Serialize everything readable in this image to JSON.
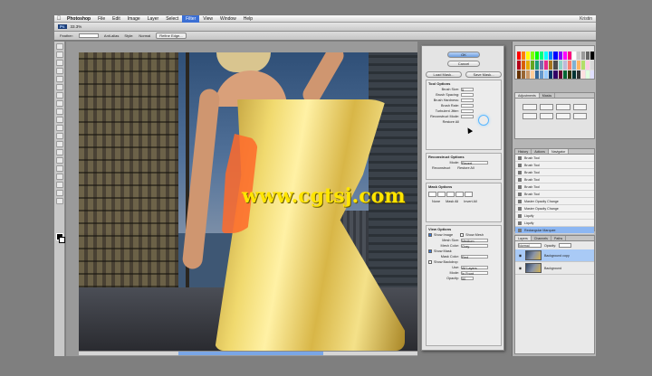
{
  "menubar": {
    "app": "Photoshop",
    "items": [
      "File",
      "Edit",
      "Image",
      "Layer",
      "Select",
      "Filter",
      "View",
      "Window",
      "Help"
    ],
    "active": "Filter",
    "right": "Kristin"
  },
  "appbar": {
    "ps": "Ps",
    "zoom": "33.3%",
    "right": ""
  },
  "optbar": {
    "label1": "Feather:",
    "label2": "Anti-alias",
    "label3": "Style:",
    "style_value": "Normal",
    "refine": "Refine Edge..."
  },
  "watermark": "www.cgtsj.com",
  "dialog": {
    "ok": "OK",
    "cancel": "Cancel",
    "load": "Load Mask...",
    "save": "Save Mask...",
    "tool_options": {
      "title": "Tool Options",
      "brush_size": "Brush Size:",
      "brush_size_value": "5",
      "rows": [
        {
          "label": "Brush Spacing:",
          "value": ""
        },
        {
          "label": "Brush Hardness:",
          "value": ""
        },
        {
          "label": "Brush Rate:",
          "value": ""
        },
        {
          "label": "Turbulent Jitter:",
          "value": ""
        },
        {
          "label": "Reconstruct Mode:",
          "value": ""
        }
      ],
      "restore": "Restore All"
    },
    "recon": {
      "title": "Reconstruct Options",
      "mode_label": "Mode:",
      "mode_value": "Revert",
      "btn1": "Reconstruct",
      "btn2": "Restore All"
    },
    "mask": {
      "title": "Mask Options",
      "none": "None",
      "mask_all": "Mask All",
      "invert": "Invert All"
    },
    "view": {
      "title": "View Options",
      "show_image": "Show Image",
      "show_mesh": "Show Mesh",
      "mesh_size_label": "Mesh Size:",
      "mesh_size": "Medium",
      "mesh_color_label": "Mesh Color:",
      "mesh_color": "Gray",
      "show_mask": "Show Mask",
      "mask_color_label": "Mask Color:",
      "mask_color": "Red",
      "show_backdrop": "Show Backdrop",
      "use_label": "Use:",
      "use_value": "All Layers",
      "mode_label": "Mode:",
      "mode_value": "In Front",
      "opacity_label": "Opacity:",
      "opacity_value": "50"
    }
  },
  "panels": {
    "swatch_colors": [
      "#ff0000",
      "#ff7f00",
      "#ffff00",
      "#7fff00",
      "#00ff00",
      "#00ff7f",
      "#00ffff",
      "#007fff",
      "#0000ff",
      "#7f00ff",
      "#ff00ff",
      "#ff007f",
      "#ffffff",
      "#cccccc",
      "#999999",
      "#666666",
      "#000000",
      "#b3001b",
      "#d95f02",
      "#e6ab02",
      "#66a61e",
      "#1b9e77",
      "#7570b3",
      "#e7298a",
      "#a6761d",
      "#4d4d4d",
      "#8dd3c7",
      "#bebada",
      "#fb8072",
      "#80b1d3",
      "#fdb462",
      "#b3de69",
      "#fccde5",
      "#d9d9d9",
      "#663300",
      "#996633",
      "#cc9966",
      "#ffcc99",
      "#336699",
      "#6699cc",
      "#99ccff",
      "#003366",
      "#330066",
      "#660033",
      "#006633",
      "#333300",
      "#003333",
      "#333333",
      "#ffe0e0",
      "#e0ffe0",
      "#e0e0ff"
    ],
    "adj_tabs": [
      "Adjustments",
      "Masks"
    ],
    "hist_tabs": [
      "History",
      "Actions",
      "Navigator"
    ],
    "history": [
      "Brush Tool",
      "Brush Tool",
      "Brush Tool",
      "Brush Tool",
      "Brush Tool",
      "Brush Tool",
      "Master Opacity Change",
      "Master Opacity Change",
      "Liquify",
      "Liquify",
      "Rectangular Marquee"
    ],
    "layer_tabs": [
      "Layers",
      "Channels",
      "Paths"
    ],
    "blend": "Normal",
    "opacity_label": "Opacity:",
    "layers": [
      "Background copy",
      "Background"
    ]
  }
}
